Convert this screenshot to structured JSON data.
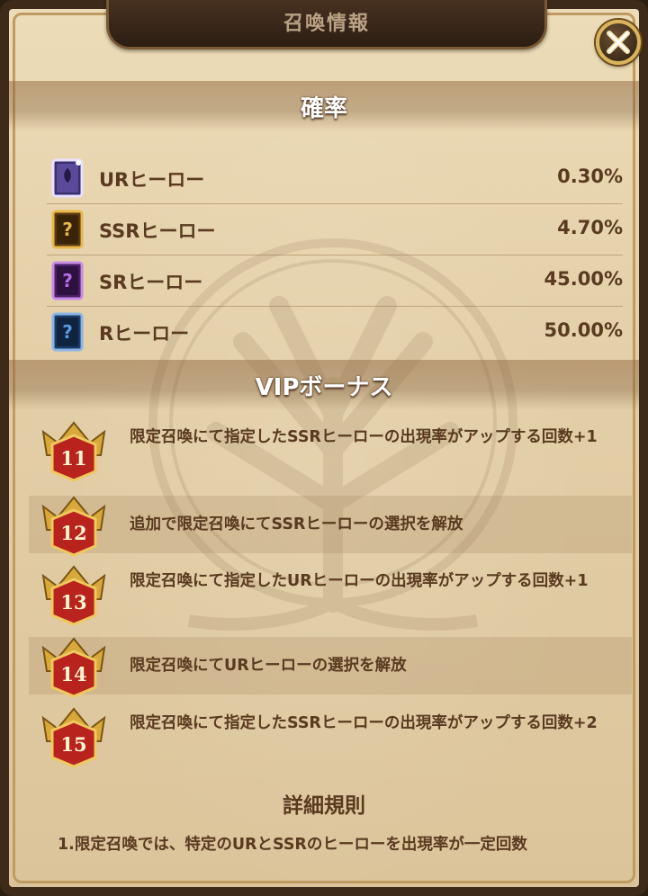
{
  "window": {
    "title": "召喚情報"
  },
  "close": {
    "icon": "close-x-icon"
  },
  "probability": {
    "header": "確率",
    "rows": [
      {
        "icon": "ur-card-icon",
        "label": "URヒーロー",
        "value": "0.30%",
        "color": "#5b4a9a"
      },
      {
        "icon": "ssr-card-icon",
        "label": "SSRヒーロー",
        "value": "4.70%",
        "color": "#c4902a"
      },
      {
        "icon": "sr-card-icon",
        "label": "SRヒーロー",
        "value": "45.00%",
        "color": "#8a3cae"
      },
      {
        "icon": "r-card-icon",
        "label": "Rヒーロー",
        "value": "50.00%",
        "color": "#2f6ab0"
      }
    ]
  },
  "vip": {
    "header": "VIPボーナス",
    "rows": [
      {
        "level": "11",
        "text": "限定召喚にて指定したSSRヒーローの出現率がアップする回数+1"
      },
      {
        "level": "12",
        "text": "追加で限定召喚にてSSRヒーローの選択を解放"
      },
      {
        "level": "13",
        "text": "限定召喚にて指定したURヒーローの出現率がアップする回数+1"
      },
      {
        "level": "14",
        "text": "限定召喚にてURヒーローの選択を解放"
      },
      {
        "level": "15",
        "text": "限定召喚にて指定したSSRヒーローの出現率がアップする回数+2"
      }
    ]
  },
  "rules": {
    "title": "詳細規則",
    "text": "1.限定召喚では、特定のURとSSRのヒーローを出現率が一定回数"
  }
}
